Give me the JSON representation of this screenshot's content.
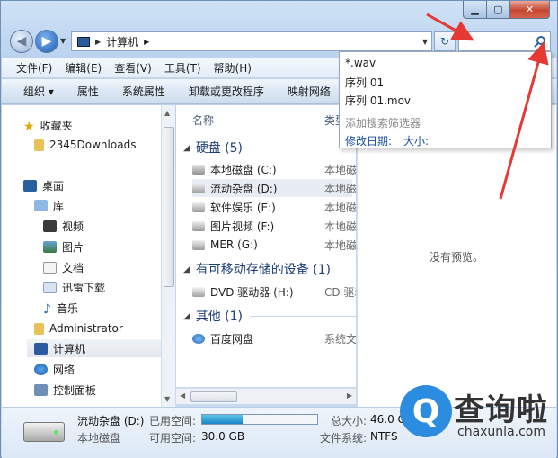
{
  "window": {
    "controls": {
      "minimize": "▁",
      "maximize": "▢",
      "close": "✕"
    }
  },
  "address": {
    "path": "计算机",
    "search_value": ""
  },
  "menubar": [
    "文件(F)",
    "编辑(E)",
    "查看(V)",
    "工具(T)",
    "帮助(H)"
  ],
  "commandbar": [
    "组织 ▾",
    "属性",
    "系统属性",
    "卸载或更改程序",
    "映射网络"
  ],
  "navpane": {
    "favorites": "收藏夹",
    "favorites_items": [
      "2345Downloads"
    ],
    "desktop": "桌面",
    "library": "库",
    "library_items": [
      "视频",
      "图片",
      "文档",
      "迅雷下载",
      "音乐"
    ],
    "admin": "Administrator",
    "computer": "计算机",
    "network": "网络",
    "control_panel": "控制面板"
  },
  "list": {
    "col_name": "名称",
    "col_type": "类型",
    "groups": [
      {
        "title": "硬盘 (5)",
        "items": [
          {
            "name": "本地磁盘 (C:)",
            "type": "本地磁"
          },
          {
            "name": "流动杂盘 (D:)",
            "type": "本地磁"
          },
          {
            "name": "软件娱乐 (E:)",
            "type": "本地磁"
          },
          {
            "name": "图片视频 (F:)",
            "type": "本地磁"
          },
          {
            "name": "MER (G:)",
            "type": "本地磁"
          }
        ]
      },
      {
        "title": "有可移动存储的设备 (1)",
        "items": [
          {
            "name": "DVD 驱动器 (H:)",
            "type": "CD 驱动"
          }
        ]
      },
      {
        "title": "其他 (1)",
        "items": [
          {
            "name": "百度网盘",
            "type": "系统文"
          }
        ]
      }
    ]
  },
  "preview": {
    "message": "没有预览。"
  },
  "details": {
    "name": "流动杂盘 (D:)",
    "kind": "本地磁盘",
    "used_label": "已用空间:",
    "free_label": "可用空间:",
    "free_value": "30.0 GB",
    "total_label": "总大小:",
    "total_value": "46.0 G",
    "fs_label": "文件系统:",
    "fs_value": "NTFS",
    "used_fraction": 0.35
  },
  "search_dropdown": {
    "suggestions": [
      "*.wav",
      "序列 01",
      "序列 01.mov"
    ],
    "hint": "添加搜索筛选器",
    "filters": [
      "修改日期:",
      "大小:"
    ]
  },
  "watermark": {
    "badge_char": "Q",
    "cn_text": "查询啦",
    "url": "chaxunla.com"
  },
  "colors": {
    "accent": "#1e3f79",
    "arrow": "#e53935",
    "watermark_blue": "#2c8de0"
  }
}
